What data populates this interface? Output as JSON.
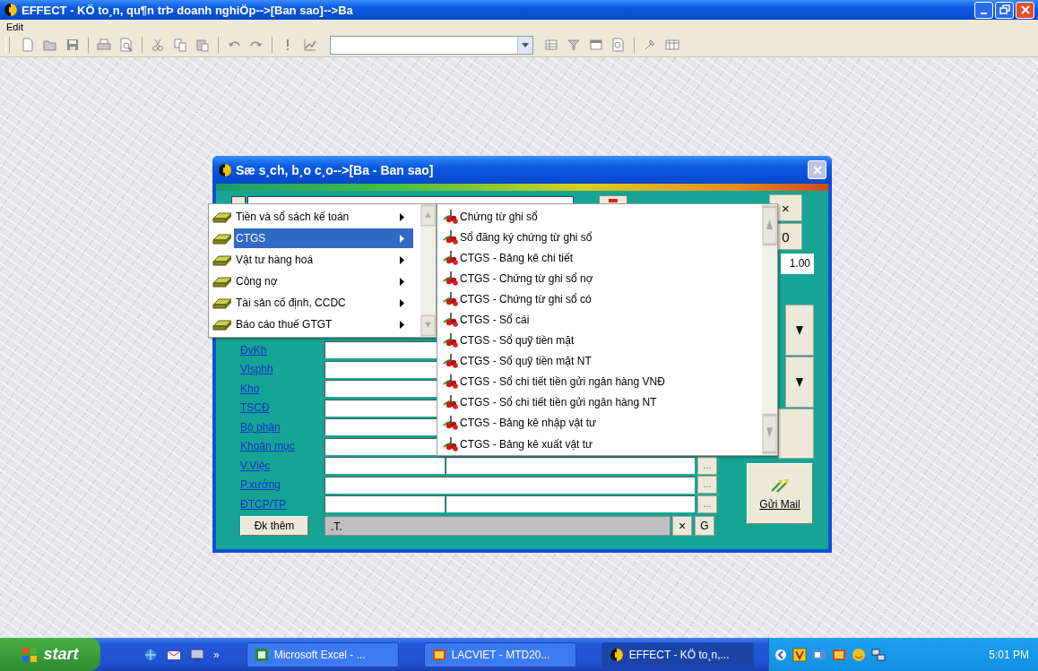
{
  "app_window": {
    "title": "EFFECT - KÖ to¸n, qu¶n trÞ doanh nghiÖp-->[Ban sao]-->Ba",
    "menu": [
      {
        "label": "Edit"
      }
    ]
  },
  "dialog": {
    "title": "Sæ s¸ch, b¸o c¸o-->[Ba - Ban sao]",
    "fields": [
      {
        "label": "ĐvKh",
        "kind": "short"
      },
      {
        "label": "Vlsphh",
        "kind": "short"
      },
      {
        "label": "Kho",
        "kind": "short"
      },
      {
        "label": "TSCĐ",
        "kind": "short"
      },
      {
        "label": "Bộ phận",
        "kind": "short"
      },
      {
        "label": "Khoản mục",
        "kind": "short"
      },
      {
        "label": "V.Việc",
        "kind": "split",
        "more_button": "..."
      },
      {
        "label": "P.xưởng",
        "kind": "wide",
        "more_button": "..."
      },
      {
        "label": "ĐTCP/TP",
        "kind": "split",
        "more_button": "..."
      }
    ],
    "add_condition_button": "Đk thêm",
    "filter_value": ".T.",
    "clear_button": "×",
    "go_button": "G",
    "close_button": "×",
    "zero_button": "0",
    "rate_value": "1.00",
    "mail_button": "Gửi Mail"
  },
  "popup_menu": {
    "items": [
      {
        "label": "Tiền và sổ sách kế toán",
        "selected": false
      },
      {
        "label": "CTGS",
        "selected": true
      },
      {
        "label": "Vật tư hàng hoá",
        "selected": false
      },
      {
        "label": "Công nợ",
        "selected": false
      },
      {
        "label": "Tài sản cố định, CCDC",
        "selected": false
      },
      {
        "label": "Báo cáo thuế GTGT",
        "selected": false
      }
    ]
  },
  "submenu": {
    "items": [
      {
        "label": "Chứng từ  ghi sổ"
      },
      {
        "label": "Sổ đăng ký chứng từ ghi sổ"
      },
      {
        "label": "CTGS - Bảng kê chi tiết"
      },
      {
        "label": "CTGS - Chứng từ ghi sổ nợ"
      },
      {
        "label": "CTGS - Chứng từ ghi sổ có"
      },
      {
        "label": "CTGS - Sổ cái"
      },
      {
        "label": "CTGS - Sổ quỹ tiền mặt"
      },
      {
        "label": "CTGS - Sổ quỹ tiền mặt NT"
      },
      {
        "label": "CTGS - Sổ chi tiết tiền gửi ngân hàng VNĐ"
      },
      {
        "label": "CTGS - Sổ chi tiết tiền gửi ngân hàng NT"
      },
      {
        "label": "CTGS - Bảng kê nhập vật tư"
      },
      {
        "label": "CTGS - Bảng  kê  xuất  vật  tư"
      }
    ]
  },
  "taskbar": {
    "start": "start",
    "overflow": "»",
    "tasks": [
      {
        "label": "Microsoft Excel - ...",
        "selected": false
      },
      {
        "label": "LACVIET - MTD20...",
        "selected": false
      },
      {
        "label": "EFFECT - KÖ to¸n,...",
        "selected": true
      }
    ],
    "clock": "5:01 PM"
  }
}
